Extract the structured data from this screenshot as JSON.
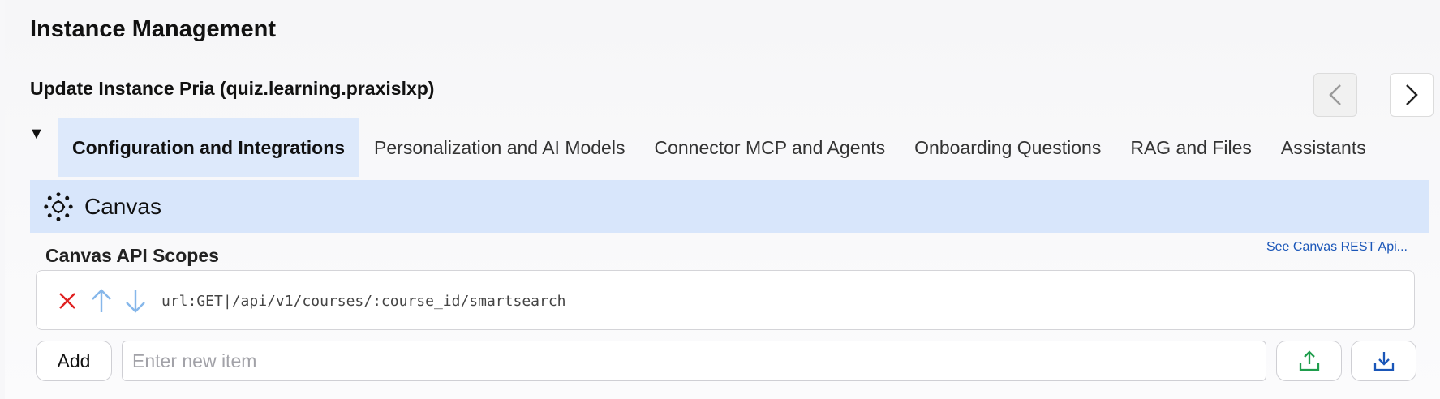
{
  "page": {
    "title": "Instance Management"
  },
  "instance": {
    "update_title": "Update Instance Pria (quiz.learning.praxislxp)"
  },
  "tabs": [
    {
      "label": "Configuration and Integrations",
      "active": true
    },
    {
      "label": "Personalization and AI Models",
      "active": false
    },
    {
      "label": "Connector MCP and Agents",
      "active": false
    },
    {
      "label": "Onboarding Questions",
      "active": false
    },
    {
      "label": "RAG and Files",
      "active": false
    },
    {
      "label": "Assistants",
      "active": false
    }
  ],
  "section": {
    "title": "Canvas",
    "icon": "canvas-logo-icon"
  },
  "scopes": {
    "label": "Canvas API Scopes",
    "doc_link": "See Canvas REST Api...",
    "items": [
      "url:GET|/api/v1/courses/:course_id/smartsearch"
    ],
    "add_label": "Add",
    "input_placeholder": "Enter new item",
    "input_value": ""
  },
  "icons": {
    "remove": "close-icon",
    "move_up": "arrow-up-icon",
    "move_down": "arrow-down-icon",
    "upload": "upload-icon",
    "download": "download-icon",
    "prev": "chevron-left-icon",
    "next": "chevron-right-icon",
    "collapse": "triangle-down-icon"
  },
  "colors": {
    "active_tab_bg": "#dde9fb",
    "section_bg": "#d8e6fb",
    "remove_icon": "#e02020",
    "arrow_icon": "#86b7ea",
    "upload_icon": "#1f9d4c",
    "download_icon": "#1a56b8",
    "link": "#1a56b8"
  }
}
